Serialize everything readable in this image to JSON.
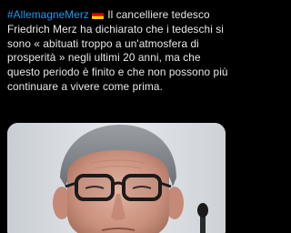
{
  "post": {
    "hashtag": "#AllemagneMerz",
    "flag_icon": "germany-flag",
    "body_text": " Il cancelliere tedesco Friedrich Merz ha dichiarato che i tedeschi si sono « abituati troppo a un'atmosfera di prosperità » negli ultimi 20 anni, ma che questo periodo è finito e che non possono più continuare a vivere come prima."
  },
  "media": {
    "subject": "portrait-photo"
  },
  "colors": {
    "background": "#000000",
    "text": "#e7e9ea",
    "hashtag": "#1d9bf0"
  }
}
